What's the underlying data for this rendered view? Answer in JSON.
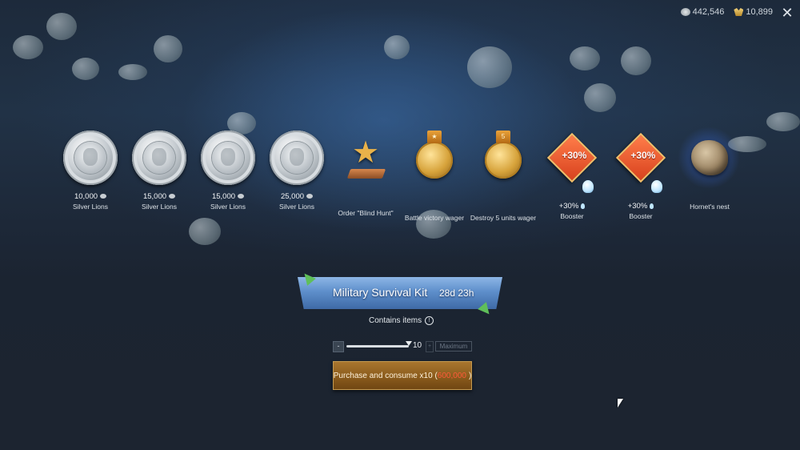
{
  "header": {
    "silver_amount": "442,546",
    "gold_amount": "10,899",
    "silver_icon": "silver-lion-icon",
    "gold_icon": "golden-eagle-icon",
    "close_icon": "close-icon"
  },
  "rewards": [
    {
      "amount": "10,000",
      "name": "Silver Lions",
      "icon": "silver-lion-coin"
    },
    {
      "amount": "15,000",
      "name": "Silver Lions",
      "icon": "silver-lion-coin"
    },
    {
      "amount": "15,000",
      "name": "Silver Lions",
      "icon": "silver-lion-coin"
    },
    {
      "amount": "25,000",
      "name": "Silver Lions",
      "icon": "silver-lion-coin"
    },
    {
      "amount": "",
      "name": "Order \"Blind Hunt\"",
      "icon": "order-star"
    },
    {
      "amount": "",
      "name": "Battle victory wager",
      "icon": "gold-medal"
    },
    {
      "amount": "",
      "name": "Destroy 5 units wager",
      "icon": "gold-medal",
      "badge": "5"
    },
    {
      "amount": "+30%",
      "name": "Booster",
      "icon": "booster",
      "badge": "+30%"
    },
    {
      "amount": "+30%",
      "name": "Booster",
      "icon": "booster",
      "badge": "+30%"
    },
    {
      "amount": "",
      "name": "Hornet's nest",
      "icon": "hornets-nest"
    }
  ],
  "banner": {
    "title": "Military Survival Kit",
    "timer": "28d 23h"
  },
  "contains": {
    "label": "Contains items",
    "icon": "info-icon"
  },
  "quantity": {
    "minus_label": "-",
    "plus_label": "+",
    "value": "10",
    "max_label": "Maximum",
    "slider_fraction": 1.0
  },
  "buy_button": {
    "label": "Purchase and consume x10 (",
    "price": "600,000",
    "suffix": ")"
  },
  "colors": {
    "price": "#ff5a3a",
    "banner": "#5e8fcb",
    "button": "#8d5e1e",
    "accent_green": "#5fbf5a"
  }
}
